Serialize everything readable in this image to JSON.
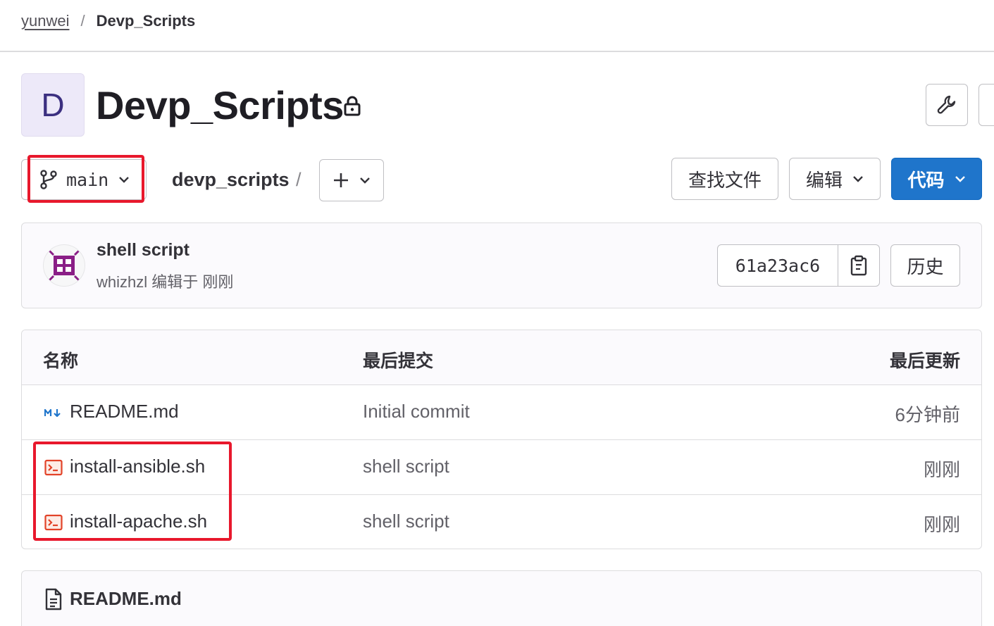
{
  "breadcrumb": {
    "namespace": "yunwei",
    "separator": "/",
    "project": "Devp_Scripts"
  },
  "project": {
    "avatar_letter": "D",
    "name": "Devp_Scripts",
    "visibility_icon": "lock-icon"
  },
  "repo_toolbar": {
    "branch": "main",
    "path": "devp_scripts",
    "path_separator": "/",
    "find_file": "查找文件",
    "edit": "编辑",
    "code": "代码"
  },
  "last_commit": {
    "title": "shell script",
    "meta": "whizhzl 编辑于 刚刚",
    "sha": "61a23ac6",
    "history": "历史"
  },
  "file_table": {
    "headers": {
      "name": "名称",
      "last_commit": "最后提交",
      "last_update": "最后更新"
    },
    "rows": [
      {
        "name": "README.md",
        "icon": "markdown-icon",
        "commit": "Initial commit",
        "updated": "6分钟前"
      },
      {
        "name": "install-ansible.sh",
        "icon": "shell-file-icon",
        "commit": "shell script",
        "updated": "刚刚"
      },
      {
        "name": "install-apache.sh",
        "icon": "shell-file-icon",
        "commit": "shell script",
        "updated": "刚刚"
      }
    ]
  },
  "readme_panel": {
    "title": "README.md"
  },
  "colors": {
    "primary": "#1f75cb",
    "highlight": "#e8182c",
    "shell_icon": "#e24329",
    "markdown_icon": "#1f75cb",
    "avatar_bg": "#ede9f9"
  }
}
